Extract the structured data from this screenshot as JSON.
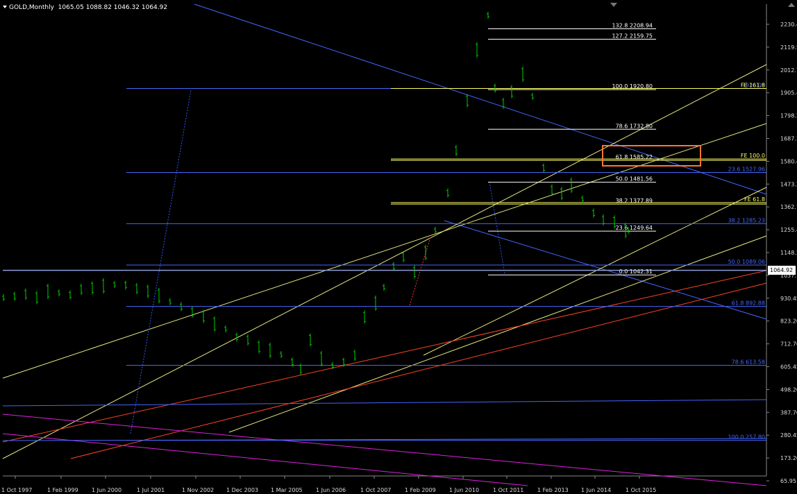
{
  "window": {
    "symbol_title": "GOLD,Monthly",
    "ohlc": "1065.05 1088.82 1046.32 1064.92",
    "current_price": "1064.92"
  },
  "colors": {
    "background": "#000000",
    "up_bar": "#00cc00",
    "text": "#ffffff",
    "fib_white": "#ffffff",
    "fib_yellow": "#ffff66",
    "fib_blue": "#4466ff",
    "channel_yellow": "#e8e880",
    "channel_red": "#ff4422",
    "channel_magenta": "#dd22dd",
    "highlight_box": "#ff7733"
  },
  "chart_data": {
    "type": "candlestick",
    "symbol": "GOLD",
    "timeframe": "Monthly",
    "y_axis_ticks": [
      "2230.45",
      "2119.55",
      "2012.70",
      "1905.45",
      "1798.20",
      "1687.30",
      "1580.45",
      "1473.20",
      "1362.70",
      "1255.45",
      "1148.20",
      "1037.70",
      "930.45",
      "823.20",
      "712.70",
      "605.45",
      "498.20",
      "387.70",
      "280.45",
      "173.20",
      "65.95"
    ],
    "x_axis_ticks": [
      "1 Oct 1997",
      "1 Feb 1999",
      "1 Jun 2000",
      "1 Jul 2001",
      "1 Nov 2002",
      "1 Dec 2003",
      "1 Mar 2005",
      "1 Jun 2006",
      "1 Oct 2007",
      "1 Feb 2009",
      "1 Jun 2010",
      "1 Oct 2011",
      "1 Feb 2013",
      "1 Jun 2014",
      "1 Oct 2015"
    ],
    "y_range": [
      65.95,
      2230.45
    ],
    "fib_retracement_white": [
      {
        "label": "132.8 2208.94",
        "value": 2208.94
      },
      {
        "label": "127.2 2159.75",
        "value": 2159.75
      },
      {
        "label": "100.0 1920.80",
        "value": 1920.8
      },
      {
        "label": "78.6 1732.80",
        "value": 1732.8
      },
      {
        "label": "50.0 1481.56",
        "value": 1481.56
      },
      {
        "label": "23.6 1249.64",
        "value": 1249.64
      },
      {
        "label": "0.0 1042.31",
        "value": 1042.31
      }
    ],
    "fib_yellow": [
      {
        "label": "61.8 1585.22",
        "value": 1585.22
      },
      {
        "label": "38.2 1377.89",
        "value": 1377.89
      }
    ],
    "fib_expansion": [
      {
        "label": "FE 161.8",
        "value": 1926.06
      },
      {
        "label": "FE 100.0",
        "value": 1592.0
      },
      {
        "label": "FE 61.8",
        "value": 1385.0
      }
    ],
    "fib_blue": [
      {
        "label": "1926.06",
        "value": 1926.06
      },
      {
        "label": "23.6 1527.96",
        "value": 1527.96
      },
      {
        "label": "38.2 1285.23",
        "value": 1285.23
      },
      {
        "label": "50.0 1089.06",
        "value": 1089.06
      },
      {
        "label": "61.8 892.88",
        "value": 892.88
      },
      {
        "label": "78.6 613.58",
        "value": 613.58
      },
      {
        "label": "100.0 257.80",
        "value": 257.8
      }
    ]
  }
}
